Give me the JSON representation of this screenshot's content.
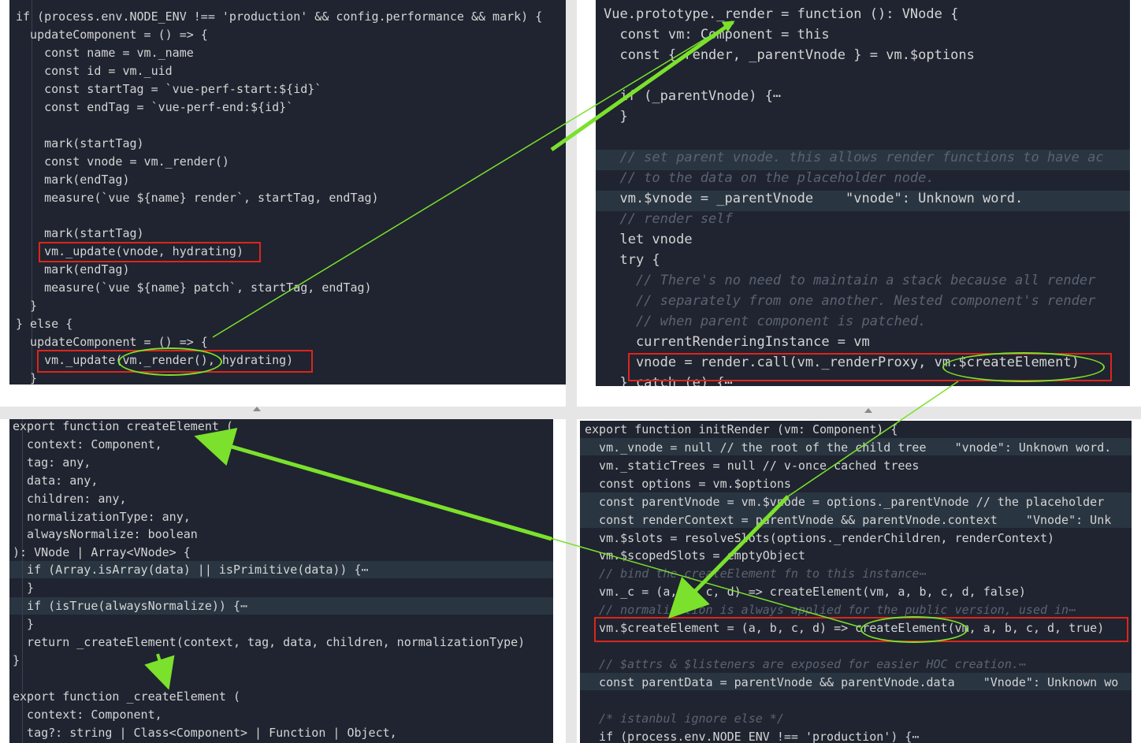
{
  "panels": {
    "top_left": {
      "lines": [
        "if (process.env.NODE_ENV !== 'production' && config.performance && mark) {",
        "  updateComponent = () => {",
        "    const name = vm._name",
        "    const id = vm._uid",
        "    const startTag = `vue-perf-start:${id}`",
        "    const endTag = `vue-perf-end:${id}`",
        "",
        "    mark(startTag)",
        "    const vnode = vm._render()",
        "    mark(endTag)",
        "    measure(`vue ${name} render`, startTag, endTag)",
        "",
        "    mark(startTag)",
        "    vm._update(vnode, hydrating)",
        "    mark(endTag)",
        "    measure(`vue ${name} patch`, startTag, endTag)",
        "  }",
        "} else {",
        "  updateComponent = () => {",
        "    vm._update(vm._render(), hydrating)",
        "  }"
      ]
    },
    "top_right": {
      "lines": [
        "Vue.prototype._render = function (): VNode {",
        "  const vm: Component = this",
        "  const { render, _parentVnode } = vm.$options",
        "",
        "  if (_parentVnode) {⋯",
        "  }",
        "",
        "  // set parent vnode. this allows render functions to have ac",
        "  // to the data on the placeholder node.",
        "  vm.$vnode = _parentVnode    \"vnode\": Unknown word.",
        "  // render self",
        "  let vnode",
        "  try {",
        "    // There's no need to maintain a stack because all render",
        "    // separately from one another. Nested component's render",
        "    // when parent component is patched.",
        "    currentRenderingInstance = vm",
        "    vnode = render.call(vm._renderProxy, vm.$createElement)",
        "  } catch (e) {⋯"
      ]
    },
    "bottom_left": {
      "lines": [
        "export function createElement (",
        "  context: Component,",
        "  tag: any,",
        "  data: any,",
        "  children: any,",
        "  normalizationType: any,",
        "  alwaysNormalize: boolean",
        "): VNode | Array<VNode> {",
        "  if (Array.isArray(data) || isPrimitive(data)) {⋯",
        "  }",
        "  if (isTrue(alwaysNormalize)) {⋯",
        "  }",
        "  return _createElement(context, tag, data, children, normalizationType)",
        "}",
        "",
        "export function _createElement (",
        "  context: Component,",
        "  tag?: string | Class<Component> | Function | Object,"
      ]
    },
    "bottom_right": {
      "lines": [
        "export function initRender (vm: Component) {",
        "  vm._vnode = null // the root of the child tree    \"vnode\": Unknown word.",
        "  vm._staticTrees = null // v-once cached trees",
        "  const options = vm.$options",
        "  const parentVnode = vm.$vnode = options._parentVnode // the placeholder",
        "  const renderContext = parentVnode && parentVnode.context    \"Vnode\": Unk",
        "  vm.$slots = resolveSlots(options._renderChildren, renderContext)",
        "  vm.$scopedSlots = emptyObject",
        "  // bind the createElement fn to this instance⋯",
        "  vm._c = (a, b, c, d) => createElement(vm, a, b, c, d, false)",
        "  // normalization is always applied for the public version, used in⋯",
        "  vm.$createElement = (a, b, c, d) => createElement(vm, a, b, c, d, true)",
        "",
        "  // $attrs & $listeners are exposed for easier HOC creation.⋯",
        "  const parentData = parentVnode && parentVnode.data    \"Vnode\": Unknown wo",
        "",
        "  /* istanbul ignore else */",
        "  if (process.env.NODE_ENV !== 'production') {⋯"
      ]
    }
  },
  "colors": {
    "editor_bg": "#1f2430",
    "highlight_box": "#e0241b",
    "arrow": "#7be12c"
  }
}
